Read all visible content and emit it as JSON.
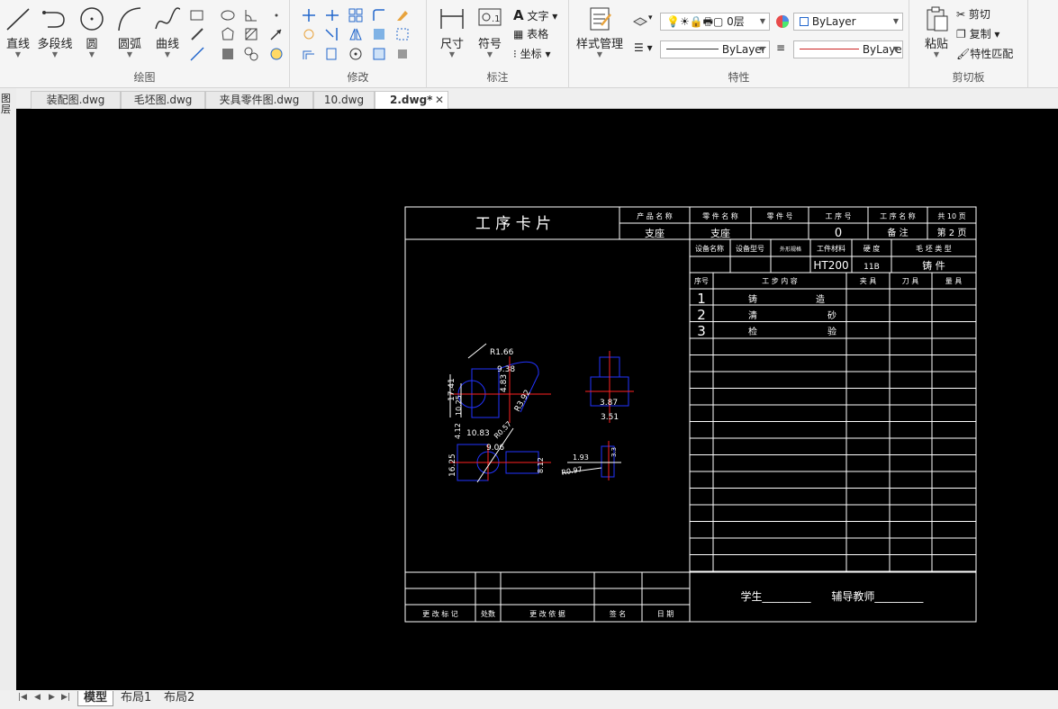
{
  "ribbon": {
    "draw": {
      "title": "绘图",
      "line": "直线",
      "polyline": "多段线",
      "circle": "圆",
      "arc": "圆弧",
      "curve": "曲线"
    },
    "modify": {
      "title": "修改"
    },
    "annotate": {
      "title": "标注",
      "dimension": "尺寸",
      "symbol": "符号",
      "text": "文字",
      "table": "表格",
      "coordinate": "坐标"
    },
    "style": {
      "label": "样式管理"
    },
    "properties": {
      "title": "特性",
      "layer_value": "0层",
      "color_value": "ByLayer",
      "linetype_value": "ByLayer",
      "lineweight_value": "ByLayer"
    },
    "clipboard": {
      "title": "剪切板",
      "paste": "粘贴",
      "cut": "剪切",
      "copy": "复制",
      "match": "特性匹配"
    }
  },
  "file_tabs": [
    {
      "label": "装配图.dwg"
    },
    {
      "label": "毛坯图.dwg"
    },
    {
      "label": "夹具零件图.dwg"
    },
    {
      "label": "10.dwg"
    },
    {
      "label": "2.dwg*",
      "active": true
    }
  ],
  "left_strip": {
    "label": "图\n层"
  },
  "drawing": {
    "title": "工 序 卡 片",
    "header": {
      "product_name_label": "产 品 名 称",
      "part_name_label": "零 件 名 称",
      "part_no_label": "零 件 号",
      "process_no_label": "工 序 号",
      "process_name_label": "工 序 名 称",
      "total_pages": "共 10 页",
      "part_name_value": "支座",
      "product_name_value": "支座",
      "process_no_value": "0",
      "remarks": "备    注",
      "page": "第 2 页"
    },
    "equipment": {
      "equip_name": "设备名称",
      "equip_model": "设备型号",
      "fixture_name": "外形规格",
      "material_label": "工件材料",
      "hardness_label": "硬 度",
      "blank_type_label": "毛 坯 类 型",
      "material_value": "HT200",
      "hardness_value": "11B",
      "blank_type_value": "铸     件"
    },
    "steps_header": {
      "no": "序号",
      "content": "工 步 内 容",
      "fixture": "夹 具",
      "tool": "刀 具",
      "gauge": "量 具"
    },
    "steps": [
      {
        "no": "1",
        "content_a": "铸",
        "content_b": "造"
      },
      {
        "no": "2",
        "content_a": "清",
        "content_b": "砂"
      },
      {
        "no": "3",
        "content_a": "检",
        "content_b": "验"
      }
    ],
    "revision_footer": {
      "mark": "更 改 标 记",
      "count": "处数",
      "basis": "更 改 依 据",
      "sign": "签 名",
      "date": "日 期"
    },
    "signature": "学生_________      辅导教师_________",
    "dimensions": [
      "R1.66",
      "9.38",
      "4.83",
      "R3.92",
      "17.41",
      "10.25",
      "4.12",
      "10.83",
      "R0.57",
      "9.06",
      "16.25",
      "8.12",
      "3.87",
      "3.51",
      "1.93",
      "R0.97",
      "3.3"
    ]
  },
  "layout_tabs": [
    {
      "label": "模型",
      "active": true
    },
    {
      "label": "布局1"
    },
    {
      "label": "布局2"
    }
  ],
  "colors": {
    "canvas": "#000000",
    "frame": "#ffffff",
    "geometry": "#2233ff",
    "centerline": "#ff2222"
  }
}
